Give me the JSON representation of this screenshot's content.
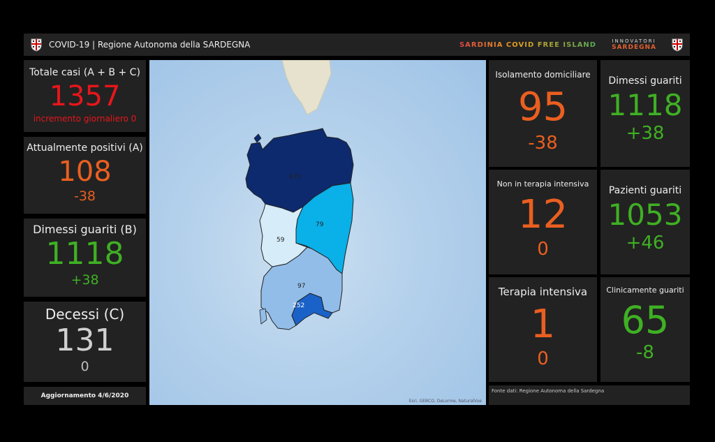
{
  "header": {
    "title": "COVID-19 | Regione Autonoma della SARDEGNA",
    "tagline": "SARDINIA COVID FREE ISLAND",
    "brand_top": "INNOVATORI",
    "brand_bottom": "SARDEGNA"
  },
  "left": {
    "total": {
      "label": "Totale casi (A + B + C)",
      "value": "1357",
      "sub": "incremento giornaliero 0"
    },
    "positive": {
      "label": "Attualmente positivi (A)",
      "value": "108",
      "delta": "-38"
    },
    "discharged": {
      "label": "Dimessi guariti (B)",
      "value": "1118",
      "delta": "+38"
    },
    "deaths": {
      "label": "Decessi (C)",
      "value": "131",
      "delta": "0"
    },
    "updated": "Aggiornamento 4/6/2020"
  },
  "map": {
    "regions": [
      {
        "name": "north",
        "value": "870",
        "color": "#0d2a6e"
      },
      {
        "name": "east",
        "value": "79",
        "color": "#0ab0e8"
      },
      {
        "name": "west",
        "value": "59",
        "color": "#d6ecf8"
      },
      {
        "name": "center-south",
        "value": "97",
        "color": "#92bde8"
      },
      {
        "name": "south",
        "value": "252",
        "color": "#1a62c8"
      }
    ],
    "attribution": "Esri, GEBCO, DeLorme, NaturalVue"
  },
  "right": {
    "home": {
      "label": "Isolamento domiciliare",
      "value": "95",
      "delta": "-38"
    },
    "non_icu": {
      "label": "Non in terapia intensiva",
      "value": "12",
      "delta": "0"
    },
    "icu": {
      "label": "Terapia intensiva",
      "value": "1",
      "delta": "0"
    },
    "disch": {
      "label": "Dimessi guariti",
      "value": "1118",
      "delta": "+38"
    },
    "patients": {
      "label": "Pazienti guariti",
      "value": "1053",
      "delta": "+46"
    },
    "clinical": {
      "label": "Clinicamente guariti",
      "value": "65",
      "delta": "-8"
    },
    "source": "Fonte dati: Regione Autonoma della Sardegna"
  }
}
